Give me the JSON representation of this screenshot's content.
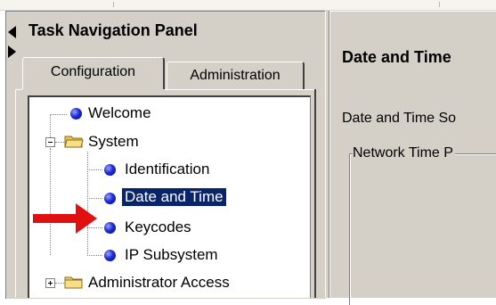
{
  "nav_panel": {
    "title": "Task Navigation Panel",
    "tabs": [
      {
        "label": "Configuration",
        "active": true
      },
      {
        "label": "Administration",
        "active": false
      }
    ],
    "tree": [
      {
        "label": "Welcome",
        "icon": "bullet-icon",
        "level": 0
      },
      {
        "label": "System",
        "icon": "folder-icon",
        "level": 0,
        "expanded": true
      },
      {
        "label": "Identification",
        "icon": "bullet-icon",
        "level": 1
      },
      {
        "label": "Date and Time",
        "icon": "bullet-icon",
        "level": 1,
        "selected": true
      },
      {
        "label": "Keycodes",
        "icon": "bullet-icon",
        "level": 1
      },
      {
        "label": "IP Subsystem",
        "icon": "bullet-icon",
        "level": 1
      },
      {
        "label": "Administrator Access",
        "icon": "folder-icon",
        "level": 0,
        "expanded": false
      }
    ]
  },
  "content": {
    "title": "Date and Time",
    "line1": "Date and Time So",
    "group_label": "Network Time P"
  },
  "colors": {
    "selection": "#0a246a",
    "annotation_arrow": "#e01010",
    "panel_bg": "#d4d0c8"
  }
}
